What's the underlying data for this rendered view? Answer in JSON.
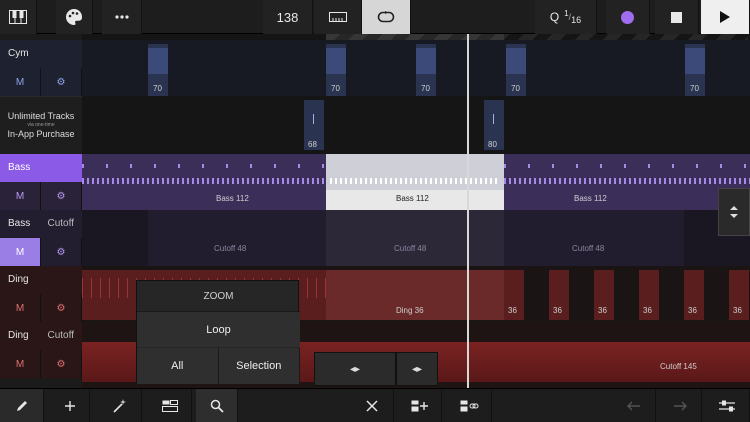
{
  "toolbar": {
    "tempo": "138",
    "quantize_q": "Q",
    "quantize_num": "1",
    "quantize_den": "16",
    "record_color": "#a06cf0"
  },
  "tracks": [
    {
      "name": "Cym",
      "sub": "",
      "mute": "M",
      "color": "#4a5a8c"
    },
    {
      "name": "Bass",
      "sub": "",
      "mute": "M",
      "color": "#7f52d8"
    },
    {
      "name": "Bass",
      "sub": "Cutoff",
      "mute": "M",
      "color": "#7f52d8"
    },
    {
      "name": "Ding",
      "sub": "",
      "mute": "M",
      "color": "#c04040"
    },
    {
      "name": "Ding",
      "sub": "Cutoff",
      "mute": "M",
      "color": "#c04040"
    }
  ],
  "promo": {
    "line1": "Unlimited Tracks",
    "line2": "via one-time",
    "line3": "In-App Purchase"
  },
  "clips": {
    "cym_vel": [
      "70",
      "70",
      "70",
      "70",
      "70"
    ],
    "snare_vel": [
      "68",
      "80"
    ],
    "bass": [
      "Bass  112",
      "Bass  112",
      "Bass  112"
    ],
    "bass_cutoff": [
      "Cutoff  48",
      "Cutoff  48",
      "Cutoff  48"
    ],
    "ding_sel": "Ding  36",
    "ding_vel": [
      "36",
      "36",
      "36",
      "36",
      "36",
      "36",
      "36"
    ],
    "ding_cutoff": "Cutoff  145"
  },
  "zoom": {
    "title": "ZOOM",
    "loop": "Loop",
    "all": "All",
    "selection": "Selection"
  }
}
